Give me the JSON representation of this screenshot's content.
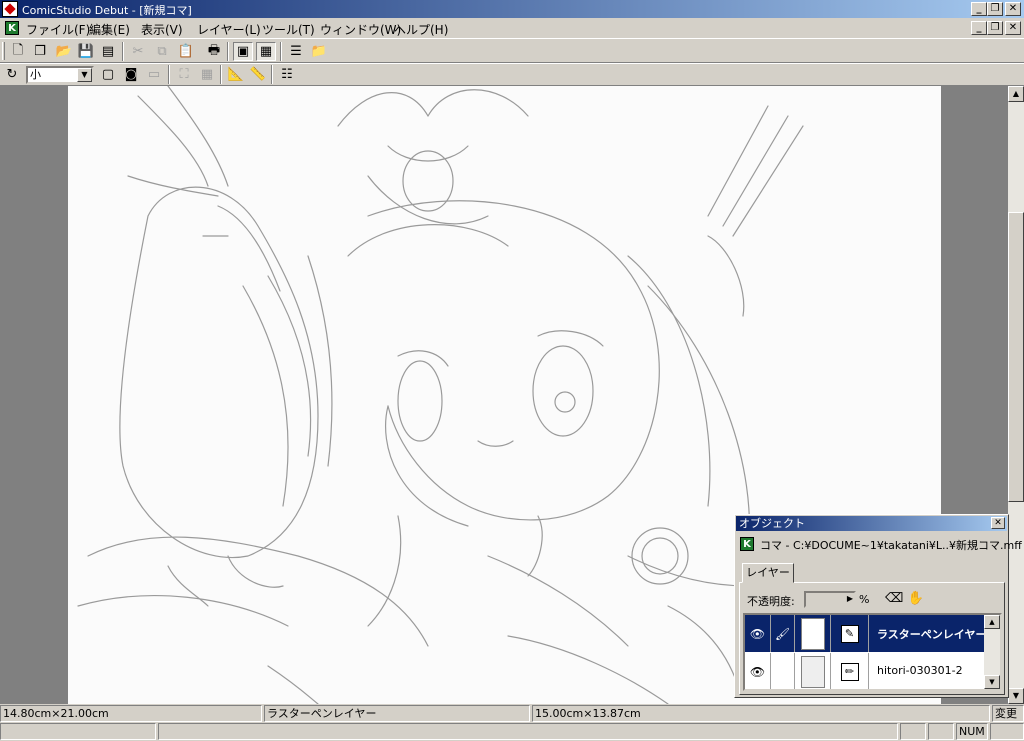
{
  "window": {
    "title": "ComicStudio Debut - [新規コマ]",
    "caption_buttons": [
      "_",
      "❐",
      "✕"
    ],
    "doc_buttons": [
      "_",
      "❐",
      "✕"
    ]
  },
  "menu": {
    "items": [
      "ファイル(F)",
      "編集(E)",
      "表示(V)",
      "レイヤー(L)",
      "ツール(T)",
      "ウィンドウ(W)",
      "ヘルプ(H)"
    ]
  },
  "toolbar2": {
    "zoom_value": "小"
  },
  "object_palette": {
    "title": "オブジェクト",
    "close": "✕",
    "path": "コマ - C:¥DOCUME~1¥takatani¥L..¥新規コマ.mff",
    "tab": "レイヤー",
    "opacity_label": "不透明度:",
    "opacity_unit": "%",
    "layers": [
      {
        "name": "ラスターペンレイヤー",
        "selected": true
      },
      {
        "name": "hitori-030301-2",
        "selected": false
      }
    ]
  },
  "statusbar": {
    "size": "14.80cm×21.00cm",
    "layer": "ラスターペンレイヤー",
    "position": "15.00cm×13.87cm",
    "change": "変更",
    "num": "NUM"
  },
  "colors": {
    "titlebar_start": "#0a246a",
    "titlebar_end": "#a6caf0",
    "selection": "#0a246a",
    "workspace": "#808080"
  }
}
